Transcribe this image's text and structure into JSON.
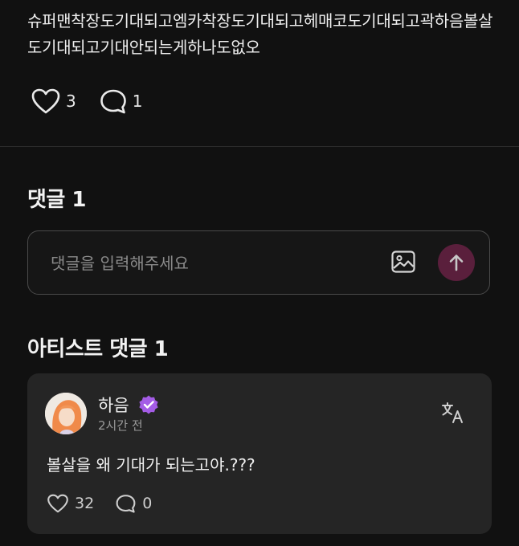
{
  "post": {
    "text": "슈퍼맨착장도기대되고엠카착장도기대되고헤매코도기대되고곽하음볼살도기대되고기대안되는게하나도없오",
    "like_count": "3",
    "comment_count": "1"
  },
  "comments": {
    "title": "댓글 1",
    "input_placeholder": "댓글을 입력해주세요"
  },
  "artist_comments": {
    "title": "아티스트 댓글 1",
    "items": [
      {
        "author": "하음",
        "time": "2시간 전",
        "text": "볼살을 왜 기대가 되는고야.???",
        "like_count": "32",
        "reply_count": "0"
      }
    ]
  },
  "icons": {
    "like": "heart-outline-icon",
    "comment": "speech-bubble-icon",
    "image": "image-icon",
    "send": "arrow-up-icon",
    "verified": "verified-badge-icon",
    "translate": "translate-icon"
  },
  "colors": {
    "background": "#111111",
    "card": "#252525",
    "send_button": "#5a1f3c",
    "verified_badge": "#a45ce6"
  }
}
